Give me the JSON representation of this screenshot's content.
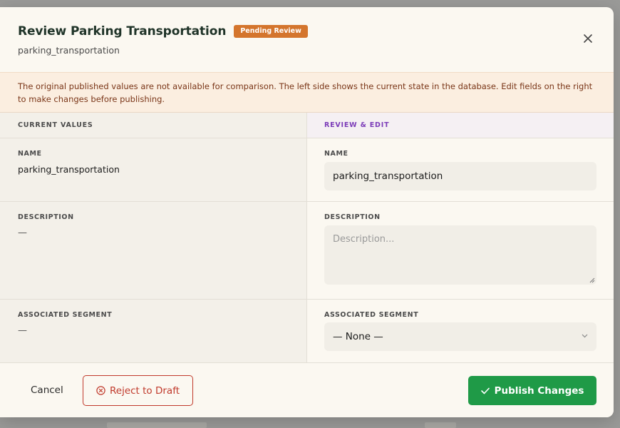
{
  "header": {
    "title": "Review Parking Transportation",
    "badge": "Pending Review",
    "subtitle": "parking_transportation"
  },
  "notice": "The original published values are not available for comparison. The left side shows the current state in the database. Edit fields on the right to make changes before publishing.",
  "current": {
    "heading": "CURRENT VALUES",
    "name_label": "NAME",
    "name_value": "parking_transportation",
    "description_label": "DESCRIPTION",
    "description_value": "—",
    "segment_label": "ASSOCIATED SEGMENT",
    "segment_value": "—"
  },
  "edit": {
    "heading": "REVIEW & EDIT",
    "name_label": "NAME",
    "name_value": "parking_transportation",
    "description_label": "DESCRIPTION",
    "description_placeholder": "Description...",
    "segment_label": "ASSOCIATED SEGMENT",
    "segment_value": "— None —"
  },
  "footer": {
    "cancel_label": "Cancel",
    "reject_label": "Reject to Draft",
    "publish_label": "Publish Changes"
  },
  "colors": {
    "badge": "#d4752d",
    "reject": "#c0392b",
    "publish": "#1f9a47",
    "edit_heading": "#7b3bb8"
  },
  "icons": {
    "close": "close-icon",
    "reject": "x-circle-icon",
    "publish": "check-icon",
    "select": "chevron-down-icon"
  }
}
